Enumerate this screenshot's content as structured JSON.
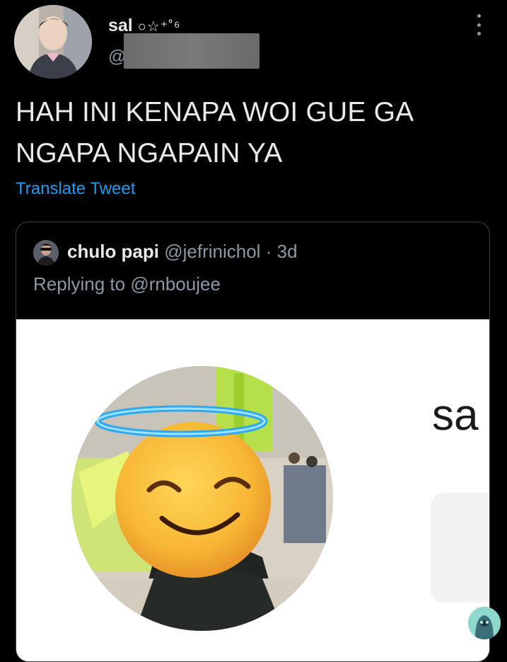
{
  "tweet": {
    "author": {
      "display_name": "sal",
      "display_emoji": "○☆⁺˚⁶",
      "handle_prefix": "@"
    },
    "text": "HAH INI KENAPA WOI GUE GA NGAPA NGAPAIN YA",
    "translate_label": "Translate Tweet",
    "more_icon": "more-vertical-icon"
  },
  "quoted_tweet": {
    "display_name": "chulo papi",
    "handle": "@jefrinichol",
    "separator": "·",
    "time": "3d",
    "replying_prefix": "Replying to",
    "replying_handle": "@rnboujee",
    "image": {
      "visible_text": "sa"
    }
  },
  "colors": {
    "background": "#000000",
    "primary_text": "#e7e9ea",
    "secondary_text": "#8b98a5",
    "link": "#1d9bf0",
    "border": "#3a3f44"
  }
}
